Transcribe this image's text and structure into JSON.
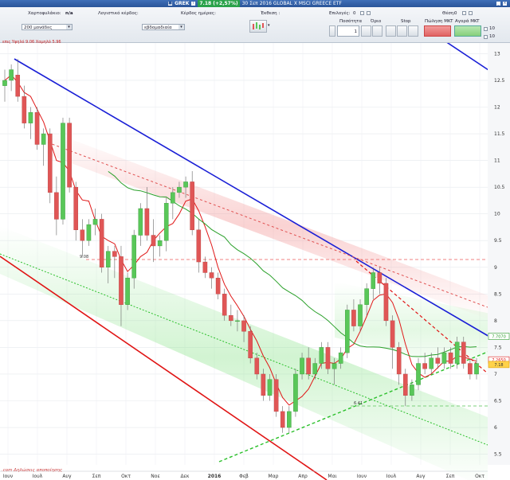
{
  "title_bar": {
    "symbol": "GREK",
    "price_badge": "7.18 (+2,57%)",
    "description": "30 Σεπ 2016 GLOBAL X MSCI GREECE ETF"
  },
  "toolbar": {
    "portfolio_label": "Χαρτοφυλάκιο:",
    "portfolio_value": "n/a",
    "units_label": "Λογιστικό κέρδος:",
    "profit_label": "Κέρδος ημέρας:",
    "view_label": "Έκθεση :",
    "units_select": "200 μονάδες",
    "period_select": "εβδομαδιαία",
    "options_label": "Επιλογές:",
    "options_value": "0",
    "position_label": "Θέση:",
    "position_value": "0",
    "quantity_label": "Ποσότητα",
    "quantity_value": "1",
    "limit_label": "Όριο",
    "stop_label": "Stop",
    "sell_label": "Πώληση MKT",
    "buy_label": "Αγορά MKT",
    "field_a": "10",
    "field_b": "10"
  },
  "chart_info": "επις Υψηλό 9.06 Χαμηλό 5.96",
  "watermark": ".com Δηλώσεις αποποίησης",
  "chart_data": {
    "type": "candlestick",
    "y_ticks": [
      "13",
      "12.5",
      "12",
      "11.5",
      "11",
      "10.5",
      "10",
      "9.5",
      "9",
      "8.5",
      "8",
      "7.5",
      "7",
      "6.5",
      "6",
      "5.5"
    ],
    "ylim": [
      5.3,
      13.2
    ],
    "x_ticks": [
      "Ιουν",
      "Ιουλ",
      "Αυγ",
      "Σεπ",
      "Οκτ",
      "Νοε",
      "Δεκ",
      "2016",
      "Φεβ",
      "Μαρ",
      "Απρ",
      "Μαι",
      "Ιουν",
      "Ιουλ",
      "Αυγ",
      "Σεπ",
      "Οκτ"
    ],
    "level_labels": [
      "9.08",
      "6.41"
    ],
    "right_badges": [
      "7.7070",
      "7.2650",
      "7.18"
    ],
    "candles": [
      [
        12.4,
        12.7,
        12.1,
        12.5
      ],
      [
        12.5,
        12.8,
        12.3,
        12.7
      ],
      [
        12.6,
        12.9,
        12.1,
        12.2
      ],
      [
        12.2,
        12.4,
        11.6,
        11.7
      ],
      [
        11.7,
        12.0,
        11.4,
        11.9
      ],
      [
        11.9,
        12.0,
        11.2,
        11.3
      ],
      [
        11.3,
        11.6,
        10.9,
        11.5
      ],
      [
        11.5,
        11.6,
        10.2,
        10.4
      ],
      [
        10.4,
        10.7,
        9.6,
        9.9
      ],
      [
        9.9,
        11.8,
        9.8,
        11.7
      ],
      [
        11.7,
        11.8,
        10.4,
        10.5
      ],
      [
        10.5,
        10.6,
        9.5,
        9.7
      ],
      [
        9.7,
        9.9,
        9.2,
        9.5
      ],
      [
        9.5,
        9.9,
        9.4,
        9.8
      ],
      [
        9.8,
        10.1,
        9.6,
        9.9
      ],
      [
        9.9,
        10.0,
        8.9,
        9.0
      ],
      [
        9.0,
        9.4,
        8.7,
        9.3
      ],
      [
        9.3,
        9.4,
        8.8,
        9.2
      ],
      [
        9.2,
        9.4,
        7.9,
        8.3
      ],
      [
        8.3,
        8.9,
        8.2,
        8.8
      ],
      [
        8.8,
        9.7,
        8.6,
        9.6
      ],
      [
        9.6,
        10.2,
        9.4,
        10.1
      ],
      [
        10.1,
        10.5,
        9.5,
        9.6
      ],
      [
        9.6,
        9.9,
        9.1,
        9.4
      ],
      [
        9.4,
        9.6,
        9.2,
        9.5
      ],
      [
        9.5,
        10.3,
        9.3,
        10.2
      ],
      [
        10.2,
        10.5,
        9.9,
        10.4
      ],
      [
        10.4,
        10.6,
        10.3,
        10.5
      ],
      [
        10.5,
        10.7,
        10.3,
        10.6
      ],
      [
        10.6,
        10.8,
        9.6,
        9.7
      ],
      [
        9.7,
        9.9,
        8.9,
        9.1
      ],
      [
        9.1,
        9.2,
        8.8,
        8.9
      ],
      [
        8.9,
        9.0,
        8.6,
        8.8
      ],
      [
        8.8,
        8.9,
        8.4,
        8.5
      ],
      [
        8.5,
        8.6,
        8.0,
        8.1
      ],
      [
        8.1,
        8.3,
        7.9,
        8.0
      ],
      [
        8.0,
        8.2,
        7.8,
        8.0
      ],
      [
        8.0,
        8.1,
        7.6,
        7.8
      ],
      [
        7.8,
        7.9,
        7.2,
        7.3
      ],
      [
        7.3,
        7.4,
        6.9,
        7.0
      ],
      [
        7.0,
        7.1,
        6.5,
        6.6
      ],
      [
        6.6,
        7.0,
        6.5,
        6.9
      ],
      [
        6.9,
        7.0,
        6.2,
        6.3
      ],
      [
        6.3,
        6.4,
        5.9,
        6.0
      ],
      [
        6.0,
        6.4,
        5.9,
        6.3
      ],
      [
        6.3,
        7.1,
        6.2,
        7.0
      ],
      [
        7.0,
        7.4,
        6.9,
        7.3
      ],
      [
        7.3,
        7.5,
        6.9,
        7.0
      ],
      [
        7.0,
        7.3,
        6.9,
        7.2
      ],
      [
        7.2,
        7.6,
        7.1,
        7.5
      ],
      [
        7.5,
        7.6,
        7.0,
        7.1
      ],
      [
        7.1,
        7.3,
        6.8,
        7.2
      ],
      [
        7.2,
        7.5,
        7.1,
        7.4
      ],
      [
        7.4,
        8.3,
        7.3,
        8.2
      ],
      [
        8.2,
        8.4,
        7.8,
        7.9
      ],
      [
        7.9,
        8.4,
        7.8,
        8.3
      ],
      [
        8.3,
        8.7,
        8.1,
        8.6
      ],
      [
        8.6,
        9.0,
        8.4,
        8.9
      ],
      [
        8.9,
        9.0,
        8.5,
        8.7
      ],
      [
        8.7,
        8.8,
        7.9,
        8.0
      ],
      [
        8.0,
        8.1,
        7.1,
        7.5
      ],
      [
        7.5,
        7.6,
        6.8,
        7.0
      ],
      [
        7.0,
        7.1,
        6.4,
        6.6
      ],
      [
        6.6,
        6.9,
        6.5,
        6.8
      ],
      [
        6.8,
        7.3,
        6.7,
        7.2
      ],
      [
        7.2,
        7.4,
        7.0,
        7.1
      ],
      [
        7.1,
        7.4,
        7.0,
        7.3
      ],
      [
        7.3,
        7.5,
        7.1,
        7.2
      ],
      [
        7.2,
        7.5,
        7.1,
        7.4
      ],
      [
        7.4,
        7.5,
        7.1,
        7.2
      ],
      [
        7.2,
        7.7,
        7.1,
        7.6
      ],
      [
        7.6,
        7.7,
        7.1,
        7.2
      ],
      [
        7.2,
        7.3,
        6.9,
        7.0
      ],
      [
        7.0,
        7.3,
        6.9,
        7.2
      ]
    ]
  },
  "icons": {
    "chart_type": "candles-chart-icon",
    "title_left": "square-icon"
  },
  "colors": {
    "title_bar": "#2a5599",
    "up": "#59c759",
    "down": "#e05656",
    "trend_blue": "#1a1fd6",
    "trend_red": "#e01414",
    "ma_red": "#e01818",
    "ma_green": "#2aa02a"
  }
}
